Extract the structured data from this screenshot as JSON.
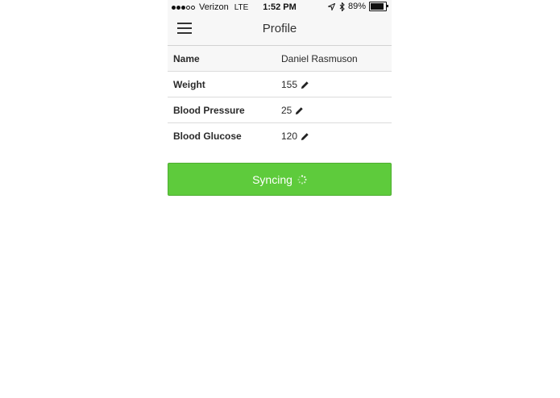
{
  "status_bar": {
    "signal": {
      "filled": 3,
      "total": 5
    },
    "carrier": "Verizon",
    "network": "LTE",
    "time": "1:52 PM",
    "battery_percent": "89%",
    "battery_level": 0.89,
    "icons": [
      "location-arrow-icon",
      "bluetooth-icon",
      "battery-icon"
    ]
  },
  "nav": {
    "title": "Profile",
    "menu_icon": "hamburger-menu-icon"
  },
  "profile": {
    "rows": [
      {
        "label": "Name",
        "value": "Daniel Rasmuson",
        "editable": false
      },
      {
        "label": "Weight",
        "value": "155",
        "editable": true
      },
      {
        "label": "Blood Pressure",
        "value": "25",
        "editable": true
      },
      {
        "label": "Blood Glucose",
        "value": "120",
        "editable": true
      }
    ],
    "edit_icon": "pencil-icon"
  },
  "sync_button": {
    "label": "Syncing",
    "icon": "spinner-icon",
    "color": "#5ecb3c"
  }
}
